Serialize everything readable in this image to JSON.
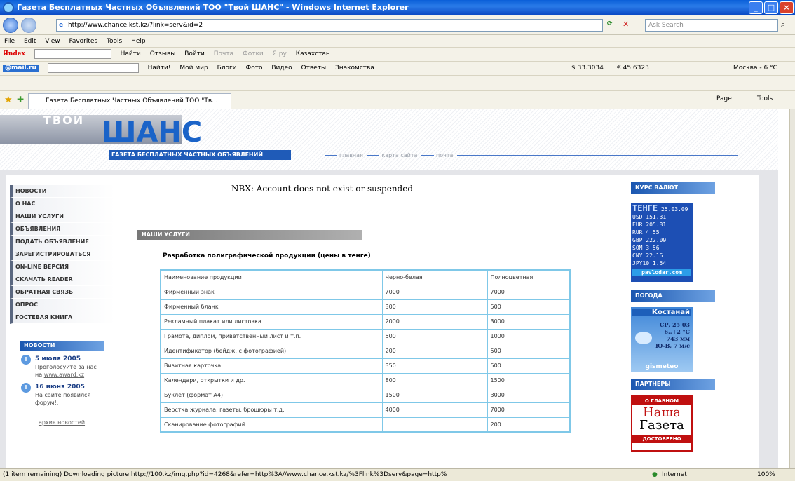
{
  "window": {
    "title": "Газета Бесплатных Частных Объявлений ТОО \"Твой ШАНС\" - Windows Internet Explorer"
  },
  "address": {
    "url": "http://www.chance.kst.kz/?link=serv&id=2",
    "search_placeholder": "Ask Search"
  },
  "menubar": [
    "File",
    "Edit",
    "View",
    "Favorites",
    "Tools",
    "Help"
  ],
  "yandex_bar": {
    "brand": "Яndex",
    "items": [
      "Найти",
      "Отзывы",
      "Войти",
      "Почта",
      "Фотки",
      "Я.ру",
      "Казахстан"
    ]
  },
  "mailru_bar": {
    "brand": "@mail.ru",
    "items": [
      "Найти!",
      "Мой мир",
      "Блоги",
      "Фото",
      "Видео",
      "Ответы",
      "Знакомства"
    ],
    "usd": "$ 33.3034",
    "eur": "€ 45.6323",
    "weather": "Москва - 6 °C"
  },
  "tab": {
    "title": "Газета Бесплатных Частных Объявлений ТОО \"Тв..."
  },
  "tab_tools": [
    "Page",
    "Tools"
  ],
  "banner": {
    "logo_small": "ТВОЙ",
    "logo_big": "ШАНС",
    "slogan": "ГАЗЕТА БЕСПЛАТНЫХ ЧАСТНЫХ ОБЪЯВЛЕНИЙ",
    "nav": [
      "главная",
      "карта сайта",
      "почта"
    ]
  },
  "left_menu": [
    "НОВОСТИ",
    "О НАС",
    "НАШИ УСЛУГИ",
    "ОБЪЯВЛЕНИЯ",
    "ПОДАТЬ ОБЪЯВЛЕНИЕ",
    "ЗАРЕГИСТРИРОВАТЬСЯ",
    "ON-LINE ВЕРСИЯ",
    "СКАЧАТЬ READER",
    "ОБРАТНАЯ СВЯЗЬ",
    "ОПРОС",
    "ГОСТЕВАЯ КНИГА"
  ],
  "news": {
    "title": "НОВОСТИ",
    "items": [
      {
        "date": "5 июля 2005",
        "text": "Проголосуйте за нас на",
        "link": "www.award.kz"
      },
      {
        "date": "16 июня 2005",
        "text": "На сайте появился форум!."
      }
    ],
    "archive": "архив новостей"
  },
  "main": {
    "error": "NBX: Account does not exist or suspended",
    "section": "НАШИ УСЛУГИ",
    "product_title": "Разработка полиграфической продукции (цены в тенге)"
  },
  "price_table": {
    "headers": [
      "Наименование продукции",
      "Черно-белая",
      "Полноцветная"
    ],
    "rows": [
      [
        "Фирменный знак",
        "7000",
        "7000"
      ],
      [
        "Фирменный бланк",
        "300",
        "500"
      ],
      [
        "Рекламный плакат или листовка",
        "2000",
        "3000"
      ],
      [
        "Грамота, диплом, приветственный лист и т.п.",
        "500",
        "1000"
      ],
      [
        "Идентификатор (бейдж, с фотографией)",
        "200",
        "500"
      ],
      [
        "Визитная карточка",
        "350",
        "500"
      ],
      [
        "Календари, открытки и др.",
        "800",
        "1500"
      ],
      [
        "Буклет (формат А4)",
        "1500",
        "3000"
      ],
      [
        "Верстка журнала, газеты, брошюры т.д.",
        "4000",
        "7000"
      ],
      [
        "Сканирование фотографий",
        "",
        "200"
      ]
    ]
  },
  "right": {
    "rates_title": "КУРС ВАЛЮТ",
    "rates_head": "ТЕНГЕ",
    "rates_date": "25.03.09",
    "rates": [
      "USD  151.31",
      "EUR  205.81",
      "RUR    4.55",
      "GBP  222.09",
      "SOM    3.56",
      "CNY   22.16",
      "JPY10  1.54"
    ],
    "rates_site": "pavlodar.com",
    "weather_title": "ПОГОДА",
    "city": "Костанай",
    "wx": [
      "СР, 25 03",
      "6..+2 °С",
      "743 мм",
      "Ю-В, 7 м/с"
    ],
    "gismeteo": "gismeteo",
    "partners_title": "ПАРТНЕРЫ",
    "partner_top": "О ГЛАВНОМ",
    "partner_name1": "Наша",
    "partner_name2": "Газета",
    "partner_bottom": "ДОСТОВЕРНО"
  },
  "status": {
    "text": "(1 item remaining) Downloading picture http://100.kz/img.php?id=4268&refer=http%3A//www.chance.kst.kz/%3Flink%3Dserv&page=http%",
    "zone": "Internet",
    "zoom": "100%"
  }
}
